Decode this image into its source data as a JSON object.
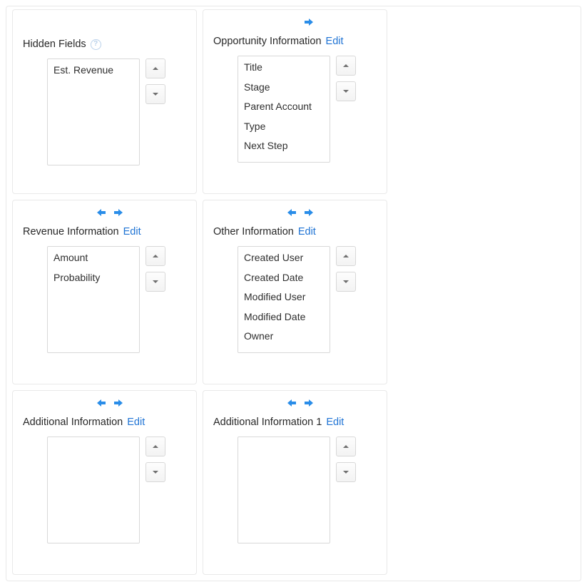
{
  "edit_label": "Edit",
  "cards": [
    {
      "key": "hidden",
      "title": "Hidden Fields",
      "arrows": {
        "left": false,
        "right": false
      },
      "help": true,
      "edit": false,
      "scroll": false,
      "items": [
        "Est. Revenue"
      ]
    },
    {
      "key": "opportunity",
      "title": "Opportunity Information",
      "arrows": {
        "left": false,
        "right": true
      },
      "help": false,
      "edit": true,
      "scroll": true,
      "items": [
        "Title",
        "Stage",
        "Parent Account",
        "Type",
        "Next Step"
      ]
    },
    {
      "key": "revenue",
      "title": "Revenue Information",
      "arrows": {
        "left": true,
        "right": true
      },
      "help": false,
      "edit": true,
      "scroll": false,
      "items": [
        "Amount",
        "Probability"
      ]
    },
    {
      "key": "other",
      "title": "Other Information",
      "arrows": {
        "left": true,
        "right": true
      },
      "help": false,
      "edit": true,
      "scroll": true,
      "items": [
        "Created User",
        "Created Date",
        "Modified User",
        "Modified Date",
        "Owner"
      ]
    },
    {
      "key": "additional",
      "title": "Additional Information",
      "arrows": {
        "left": true,
        "right": true
      },
      "help": false,
      "edit": true,
      "scroll": false,
      "items": []
    },
    {
      "key": "additional1",
      "title": "Additional Information 1",
      "arrows": {
        "left": true,
        "right": true
      },
      "help": false,
      "edit": true,
      "scroll": false,
      "items": []
    }
  ]
}
